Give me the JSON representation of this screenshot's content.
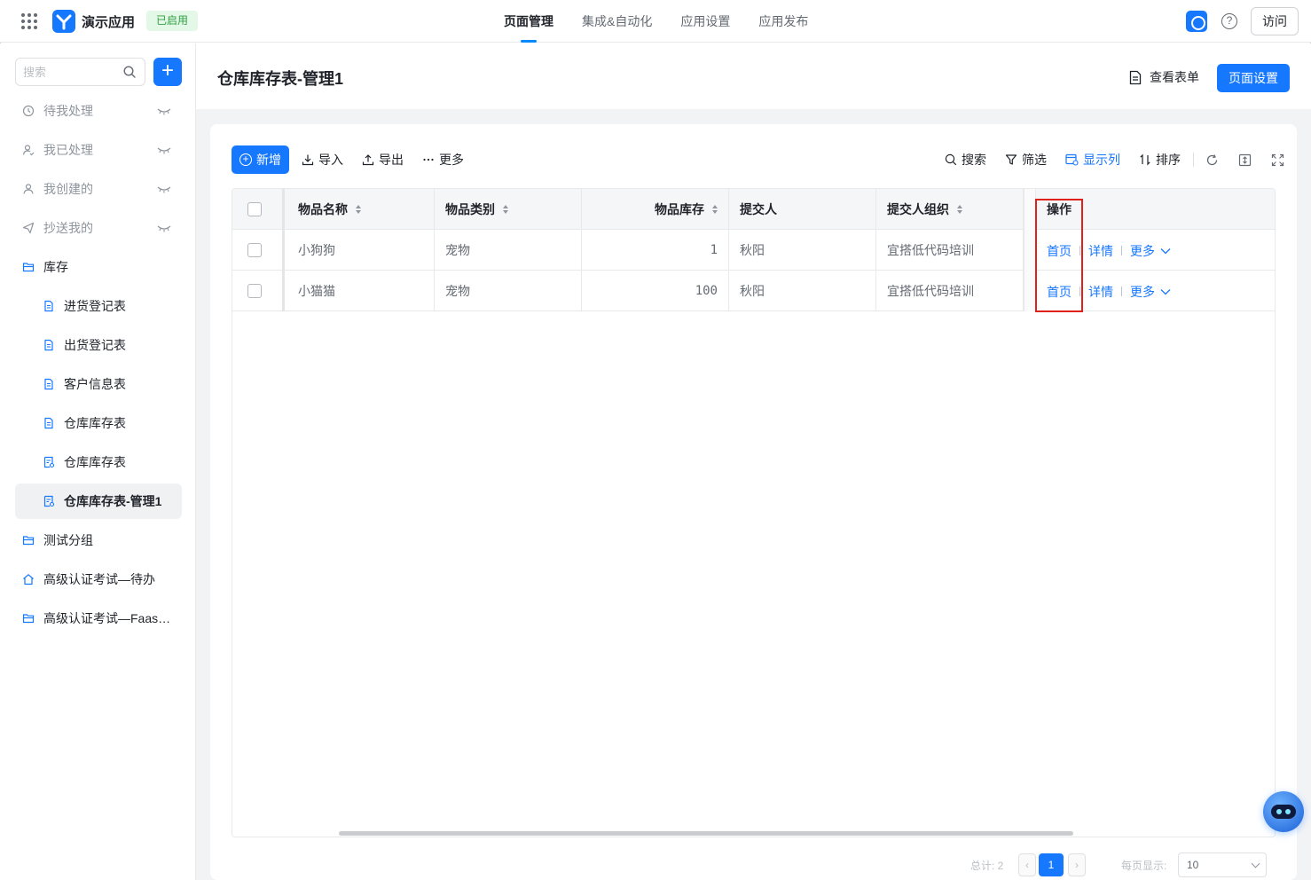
{
  "topbar": {
    "app_name": "演示应用",
    "status": "已启用",
    "tabs": [
      {
        "label": "页面管理",
        "active": true
      },
      {
        "label": "集成&自动化",
        "active": false
      },
      {
        "label": "应用设置",
        "active": false
      },
      {
        "label": "应用发布",
        "active": false
      }
    ],
    "help_glyph": "?",
    "visit_label": "访问",
    "accent_color": "#1677ff"
  },
  "sidebar": {
    "search_placeholder": "搜索",
    "add_glyph": "+",
    "items": [
      {
        "label": "待我处理",
        "icon": "clock-icon",
        "muted": true
      },
      {
        "label": "我已处理",
        "icon": "user-check-icon",
        "muted": true
      },
      {
        "label": "我创建的",
        "icon": "user-icon",
        "muted": true
      },
      {
        "label": "抄送我的",
        "icon": "send-icon",
        "muted": true
      },
      {
        "label": "库存",
        "icon": "folder-open-icon",
        "muted": false
      },
      {
        "label": "进货登记表",
        "icon": "form-icon",
        "muted": false
      },
      {
        "label": "出货登记表",
        "icon": "form-icon",
        "muted": false
      },
      {
        "label": "客户信息表",
        "icon": "form-icon",
        "muted": false
      },
      {
        "label": "仓库库存表",
        "icon": "form-icon",
        "muted": false
      },
      {
        "label": "仓库库存表",
        "icon": "report-icon",
        "muted": false
      },
      {
        "label": "仓库库存表-管理1",
        "icon": "report-icon",
        "muted": false,
        "active": true
      },
      {
        "label": "测试分组",
        "icon": "folder-icon",
        "muted": false
      },
      {
        "label": "高级认证考试—待办",
        "icon": "home-icon",
        "muted": false
      },
      {
        "label": "高级认证考试—Faas…",
        "icon": "folder-icon",
        "muted": false
      }
    ]
  },
  "header": {
    "title": "仓库库存表-管理1",
    "view_form_label": "查看表单",
    "page_settings_label": "页面设置"
  },
  "toolbar": {
    "new_label": "新增",
    "new_glyph": "+",
    "import_label": "导入",
    "export_label": "导出",
    "more_label": "更多",
    "search_label": "搜索",
    "filter_label": "筛选",
    "columns_label": "显示列",
    "sort_label": "排序"
  },
  "table": {
    "columns": [
      "物品名称",
      "物品类别",
      "物品库存",
      "提交人",
      "提交人组织",
      "操作"
    ],
    "rows": [
      {
        "name": "小狗狗",
        "category": "宠物",
        "stock": "1",
        "submitter": "秋阳",
        "org": "宜搭低代码培训"
      },
      {
        "name": "小猫猫",
        "category": "宠物",
        "stock": "100",
        "submitter": "秋阳",
        "org": "宜搭低代码培训"
      }
    ],
    "actions": {
      "home": "首页",
      "detail": "详情",
      "more": "更多"
    }
  },
  "pager": {
    "total": "总计: 2",
    "prev_glyph": "‹",
    "current_page": "1",
    "next_glyph": "›",
    "per_page_label": "每页显示:",
    "per_page_value": "10"
  }
}
